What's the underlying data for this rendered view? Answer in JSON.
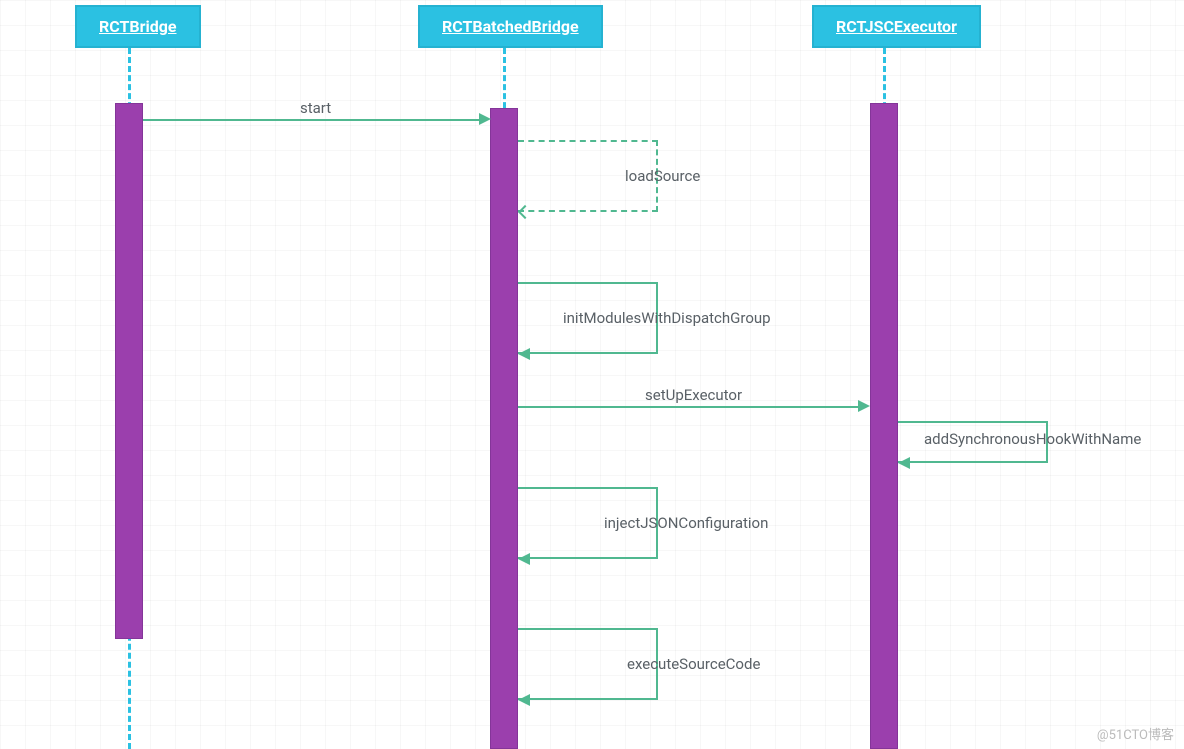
{
  "participants": {
    "p0": "RCTBridge",
    "p1": "RCTBatchedBridge",
    "p2": "RCTJSCExecutor"
  },
  "messages": {
    "m1": "start",
    "m2": "loadSource",
    "m3": "initModulesWithDispatchGroup",
    "m4": "setUpExecutor",
    "m5": "addSynchronousHookWithName",
    "m6": "injectJSONConfiguration",
    "m7": "executeSourceCode"
  },
  "watermark": "@51CTO博客",
  "colors": {
    "header_bg": "#2bc1e2",
    "activation": "#9b3fad",
    "arrow": "#50b890"
  }
}
